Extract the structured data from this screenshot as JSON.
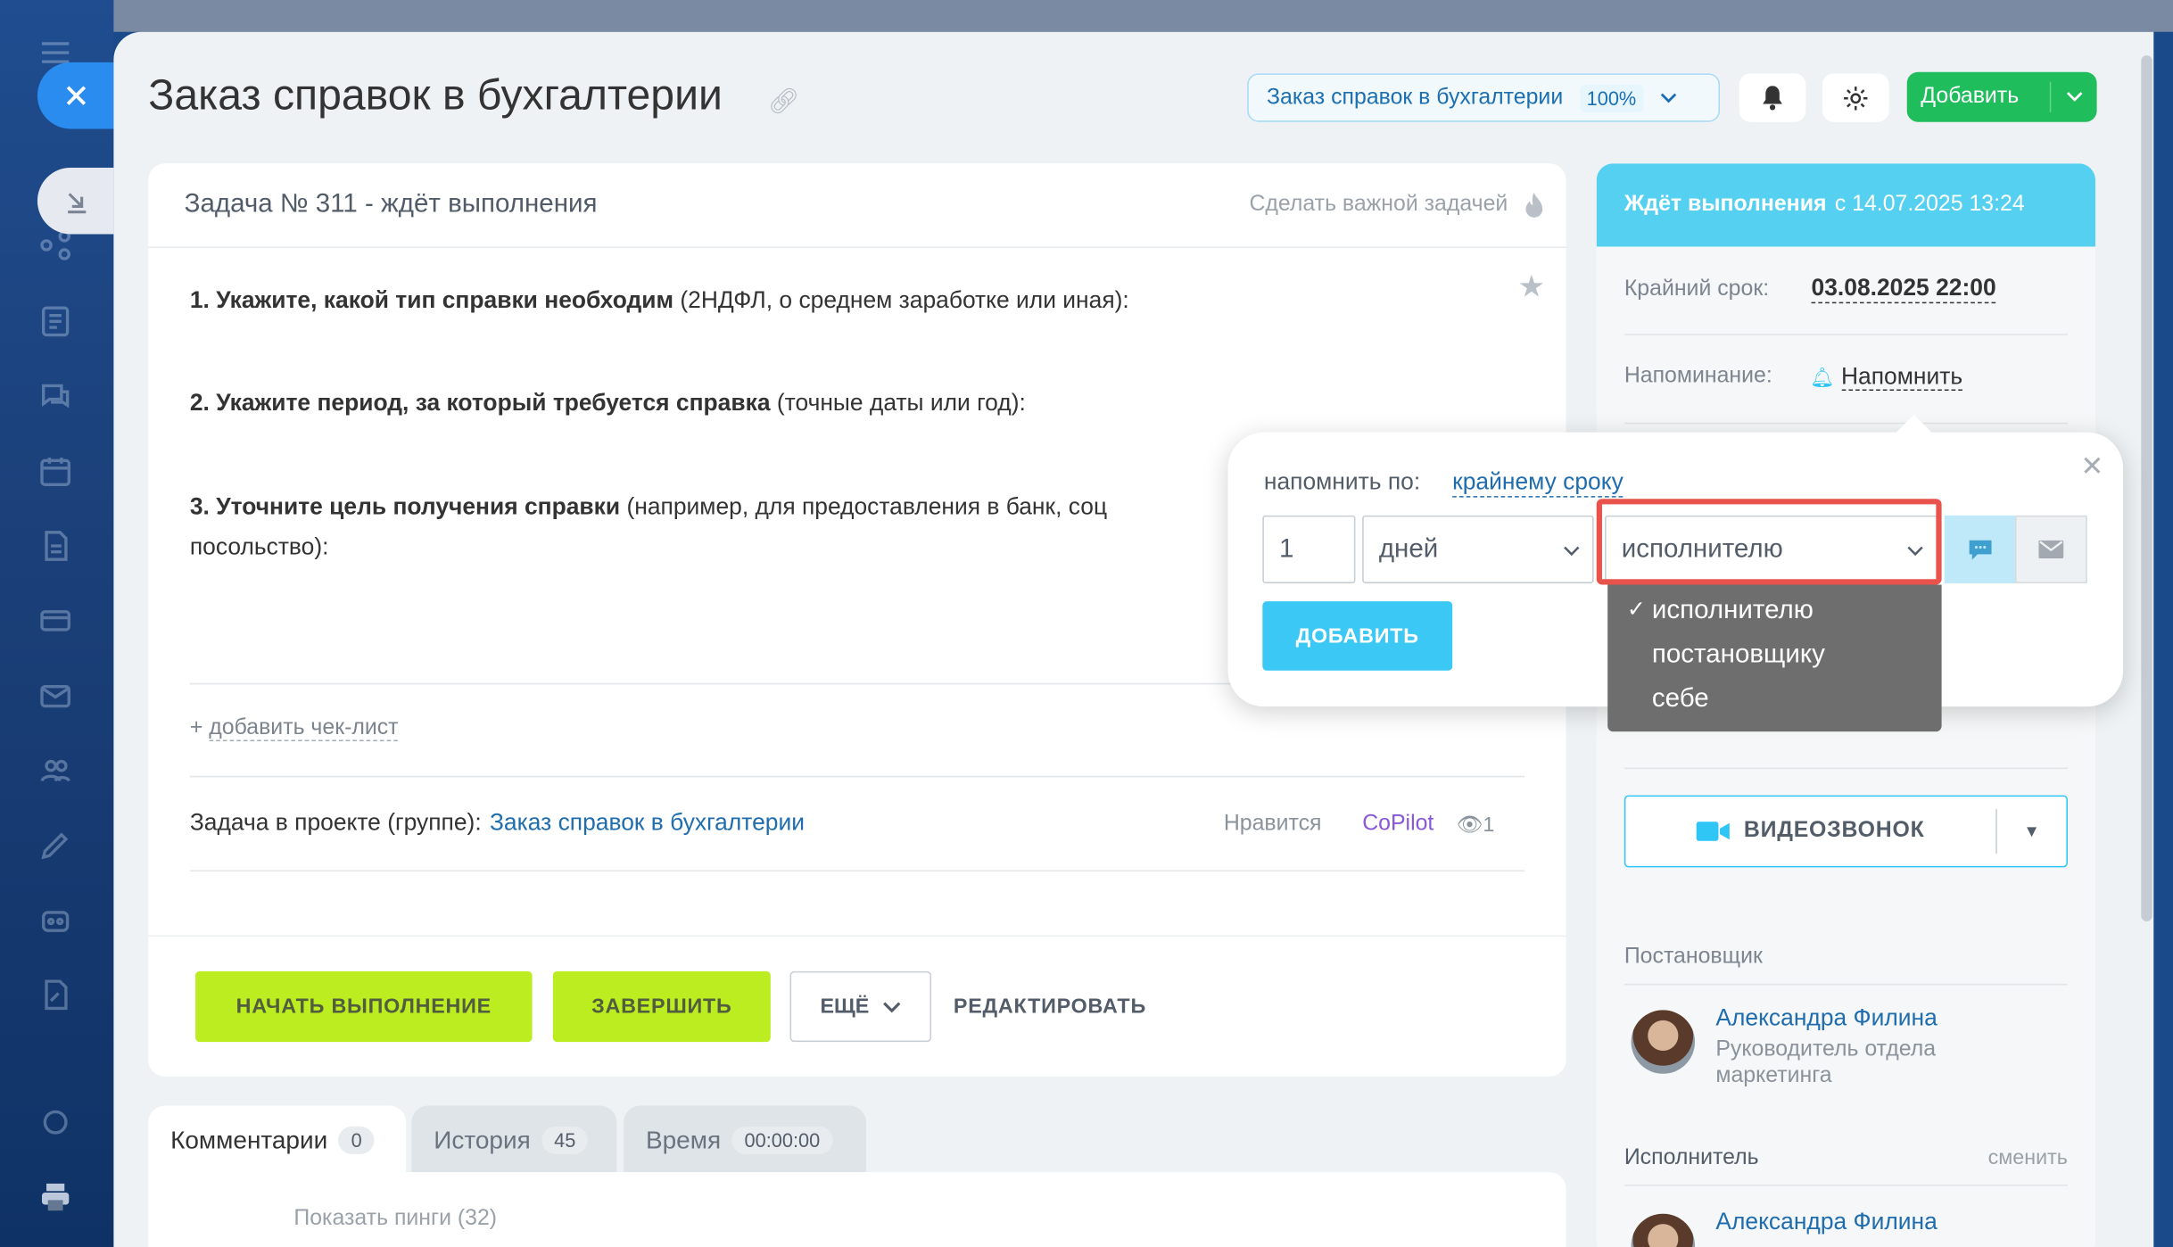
{
  "header": {
    "title": "Заказ справок в бухгалтерии",
    "project_selector": {
      "label": "Заказ справок в бухгалтерии",
      "percent": "100%"
    },
    "add_button": "Добавить"
  },
  "task": {
    "status_title": "Задача № 311 - ждёт выполнения",
    "make_important": "Сделать важной задачей",
    "questions": [
      {
        "bold": "1. Укажите, какой тип справки необходим",
        "rest": " (2НДФЛ, о среднем заработке или иная):"
      },
      {
        "bold": "2. Укажите период, за который требуется справка",
        "rest": " (точные даты или год):"
      },
      {
        "bold": "3. Уточните цель получения справки",
        "rest": " (например, для предоставления в банк, соц",
        "rest2": "посольство):"
      }
    ],
    "add_checklist": "добавить чек-лист",
    "add_checklist_plus": "+",
    "project_label": "Задача в проекте (группе):",
    "project_link": "Заказ справок в бухгалтерии",
    "like": "Нравится",
    "copilot": "CoPilot",
    "views": "1",
    "buttons": {
      "start": "НАЧАТЬ ВЫПОЛНЕНИЕ",
      "finish": "ЗАВЕРШИТЬ",
      "more": "ЕЩЁ",
      "edit": "РЕДАКТИРОВАТЬ"
    }
  },
  "tabs": [
    {
      "label": "Комментарии",
      "count": "0"
    },
    {
      "label": "История",
      "count": "45"
    },
    {
      "label": "Время",
      "count": "00:00:00"
    }
  ],
  "show_pings": "Показать пинги (32)",
  "sidebar": {
    "status_bold": "Ждёт выполнения",
    "status_rest": "с 14.07.2025 13:24",
    "deadline_label": "Крайний срок:",
    "deadline_value": "03.08.2025 22:00",
    "reminder_label": "Напоминание:",
    "reminder_link": "Напомнить",
    "video_call": "ВИДЕОЗВОНОК",
    "creator_label": "Постановщик",
    "creator_name": "Александра Филина",
    "creator_role": "Руководитель отдела маркетинга",
    "assignee_label": "Исполнитель",
    "assignee_change": "сменить",
    "assignee_name": "Александра Филина"
  },
  "reminder_popup": {
    "label": "напомнить по:",
    "link": "крайнему сроку",
    "amount": "1",
    "unit": "дней",
    "recipient": "исполнителю",
    "add_button": "ДОБАВИТЬ",
    "options": [
      "исполнителю",
      "постановщику",
      "себе"
    ],
    "selected_mark": "✓"
  },
  "colors": {
    "accent_green": "#1fbd5c",
    "lime": "#bbed21",
    "status_cyan": "#56d0f0",
    "highlight_red": "#e8534c"
  }
}
